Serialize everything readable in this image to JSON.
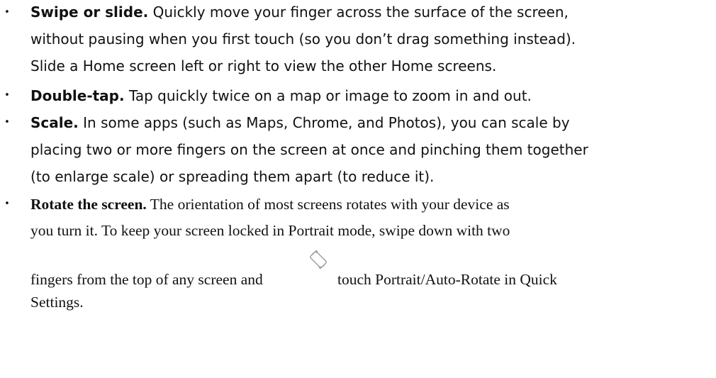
{
  "items": [
    {
      "term": "Swipe or slide.",
      "lines": [
        " Quickly move your finger across the surface of the screen,",
        "without pausing when you first touch (so you don’t drag something instead).",
        "Slide a Home screen left or right to view the other Home screens."
      ]
    },
    {
      "term": "Double-tap.",
      "lines": [
        " Tap quickly twice on a map or image to zoom in and out."
      ]
    },
    {
      "term": "Scale.",
      "lines": [
        " In some apps (such as Maps, Chrome, and Photos), you can scale by",
        "placing two or more fingers on the screen at once and pinching them together",
        "(to enlarge scale) or spreading them apart (to reduce it)."
      ]
    },
    {
      "term": "Rotate the screen.",
      "lines": [
        " The orientation of most screens rotates with your device as",
        "you turn it. To keep your screen locked in Portrait mode, swipe down with two"
      ],
      "icon_line_before": "fingers from the top of any screen and",
      "icon_name": "rotate-icon",
      "icon_line_after": "touch Portrait/Auto-Rotate in Quick",
      "last_line": "Settings."
    }
  ],
  "bullet_char": "•"
}
